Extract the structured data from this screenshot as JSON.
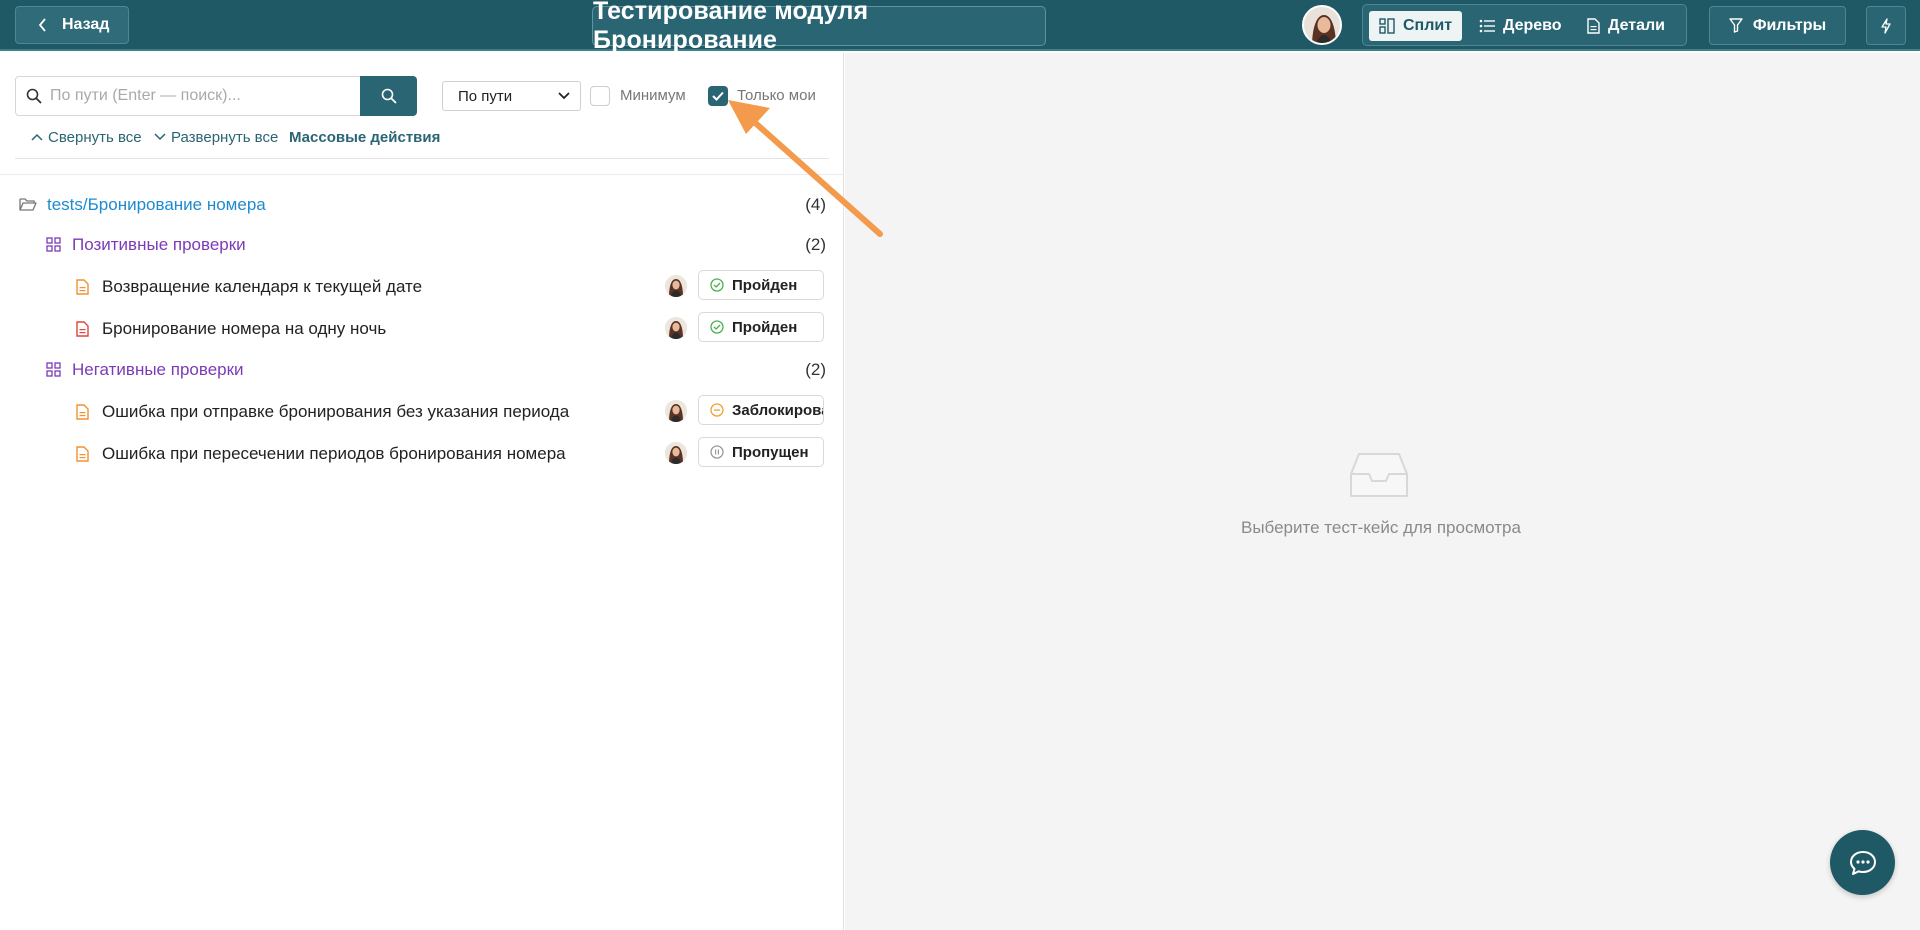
{
  "header": {
    "back_label": "Назад",
    "title": "Тестирование модуля Бронирование",
    "views": [
      {
        "label": "Сплит",
        "icon": "split-icon",
        "active": true
      },
      {
        "label": "Дерево",
        "icon": "list-icon",
        "active": false
      },
      {
        "label": "Детали",
        "icon": "document-icon",
        "active": false
      }
    ],
    "filters_label": "Фильтры"
  },
  "toolbar": {
    "search_placeholder": "По пути (Enter — поиск)...",
    "search_value": "",
    "sort_value": "По пути",
    "minimum_label": "Минимум",
    "minimum_checked": false,
    "only_mine_label": "Только мои",
    "only_mine_checked": true,
    "collapse_all": "Свернуть все",
    "expand_all": "Развернуть все",
    "bulk_actions": "Массовые действия"
  },
  "tree": {
    "folder": {
      "label": "tests/Бронирование номера",
      "count": "(4)"
    },
    "suites": [
      {
        "label": "Позитивные проверки",
        "count": "(2)",
        "cases": [
          {
            "label": "Возвращение календаря к текущей дате",
            "status": "Пройден",
            "status_type": "passed",
            "icon_color": "#f0922e"
          },
          {
            "label": "Бронирование номера на одну ночь",
            "status": "Пройден",
            "status_type": "passed",
            "icon_color": "#e0443e"
          }
        ]
      },
      {
        "label": "Негативные проверки",
        "count": "(2)",
        "cases": [
          {
            "label": "Ошибка при отправке бронирования без указания периода",
            "status": "Заблокирован",
            "status_type": "blocked",
            "icon_color": "#f0922e"
          },
          {
            "label": "Ошибка при пересечении периодов бронирования номера",
            "status": "Пропущен",
            "status_type": "skipped",
            "icon_color": "#f0922e"
          }
        ]
      }
    ]
  },
  "detail": {
    "empty_text": "Выберите тест-кейс для просмотра"
  },
  "colors": {
    "header_bg": "#1f5966",
    "accent": "#2a6573",
    "folder": "#1e8ad0",
    "suite": "#7c3ab7",
    "passed": "#4caf50",
    "blocked": "#f0a030",
    "skipped": "#9a9a9a",
    "annotation_arrow": "#f39a4c"
  }
}
